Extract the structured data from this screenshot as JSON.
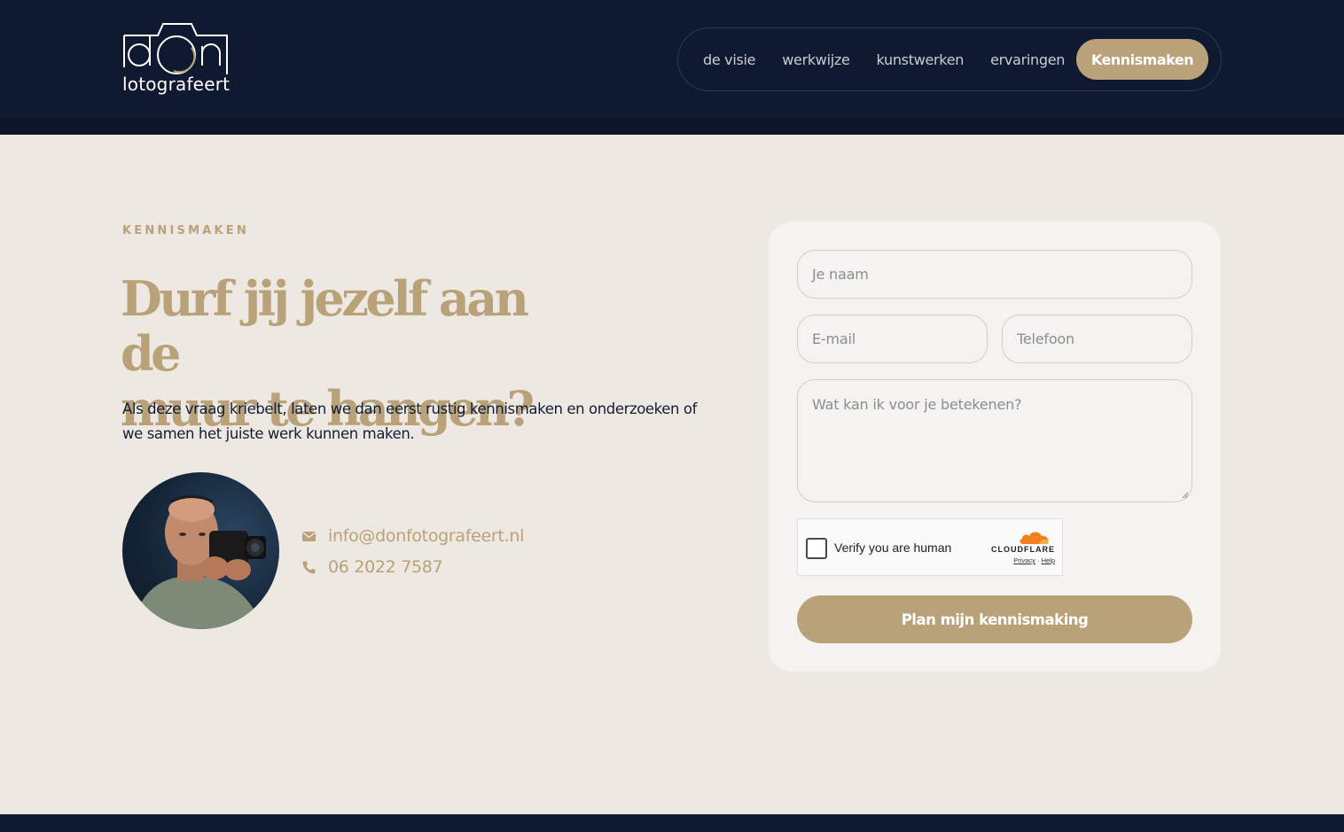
{
  "header": {
    "logo_text": "don",
    "logo_subtitle": "lotografeert",
    "nav": [
      {
        "label": "de visie"
      },
      {
        "label": "werkwijze"
      },
      {
        "label": "kunstwerken"
      },
      {
        "label": "ervaringen"
      }
    ],
    "cta_label": "Kennismaken"
  },
  "main": {
    "eyebrow": "KENNISMAKEN",
    "headline_line1": "Durf jij jezelf aan de",
    "headline_line2": "muur te hangen?",
    "intro": "Als deze vraag kriebelt, laten we dan eerst rustig kennismaken en onderzoeken of we samen het juiste werk kunnen maken.",
    "email": "info@donfotografeert.nl",
    "phone": "06 2022 7587"
  },
  "form": {
    "name_placeholder": "Je naam",
    "email_placeholder": "E-mail",
    "phone_placeholder": "Telefoon",
    "message_placeholder": "Wat kan ik voor je betekenen?",
    "captcha_label": "Verify you are human",
    "captcha_brand": "CLOUDFLARE",
    "captcha_privacy": "Privacy",
    "captcha_help": "Help",
    "submit_label": "Plan mijn kennismaking"
  },
  "colors": {
    "navy": "#0f1a30",
    "gold": "#b9a27a",
    "background": "#ede9e2",
    "card": "#f5f3ef"
  }
}
